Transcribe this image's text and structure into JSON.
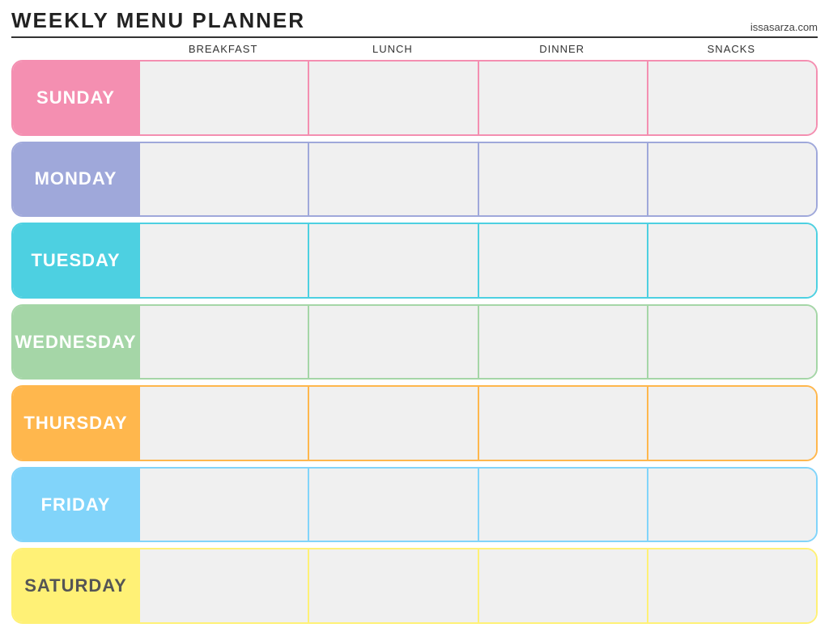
{
  "header": {
    "title": "Weekly Menu Planner",
    "website": "issasarza.com"
  },
  "columns": {
    "spacer": "",
    "breakfast": "Breakfast",
    "lunch": "Lunch",
    "dinner": "Dinner",
    "snacks": "Snacks"
  },
  "days": [
    {
      "id": "sunday",
      "label": "Sunday",
      "colorClass": "row-sunday"
    },
    {
      "id": "monday",
      "label": "Monday",
      "colorClass": "row-monday"
    },
    {
      "id": "tuesday",
      "label": "Tuesday",
      "colorClass": "row-tuesday"
    },
    {
      "id": "wednesday",
      "label": "Wednesday",
      "colorClass": "row-wednesday"
    },
    {
      "id": "thursday",
      "label": "Thursday",
      "colorClass": "row-thursday"
    },
    {
      "id": "friday",
      "label": "Friday",
      "colorClass": "row-friday"
    },
    {
      "id": "saturday",
      "label": "Saturday",
      "colorClass": "row-saturday"
    }
  ]
}
